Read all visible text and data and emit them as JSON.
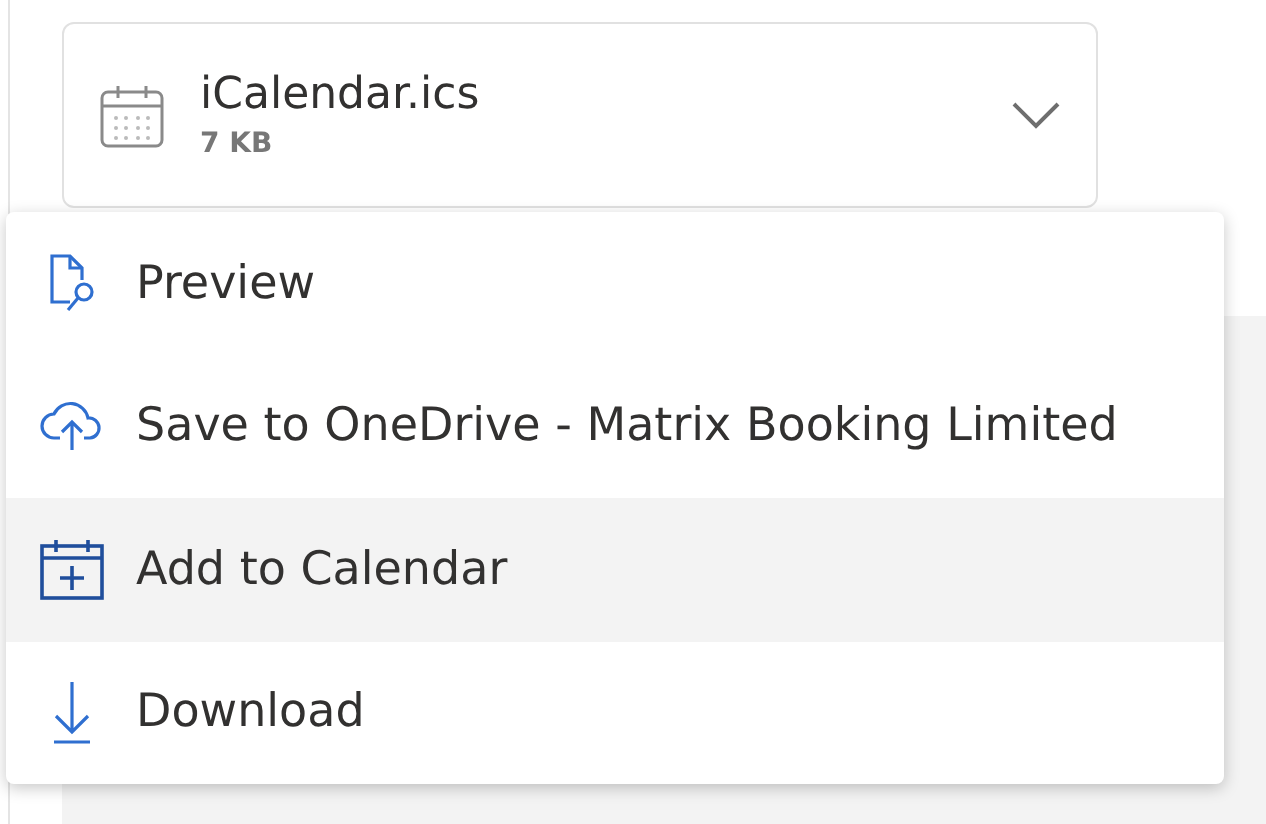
{
  "attachment": {
    "name": "iCalendar.ics",
    "size": "7 KB",
    "expanded": true
  },
  "menu": [
    {
      "kind": "preview",
      "label": "Preview",
      "selected": false
    },
    {
      "kind": "cloud",
      "label": "Save to OneDrive - Matrix Booking Limited",
      "selected": false
    },
    {
      "kind": "calendar",
      "label": "Add to Calendar",
      "selected": true
    },
    {
      "kind": "download",
      "label": "Download",
      "selected": false
    }
  ]
}
